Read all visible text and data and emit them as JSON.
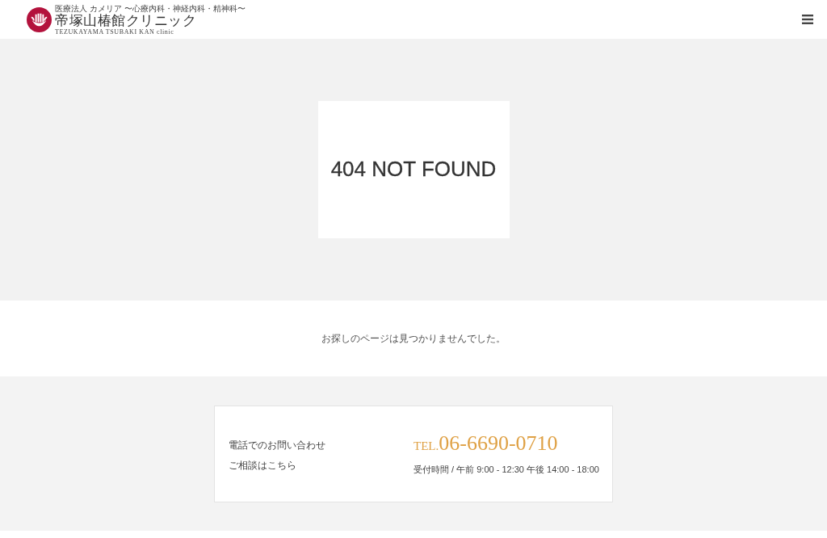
{
  "header": {
    "logo": {
      "tagline": "医療法人 カメリア 〜心療内科・神経内科・精神科〜",
      "name": "帝塚山椿館クリニック",
      "romaji": "TEZUKAYAMA TSUBAKI KAN clinic"
    }
  },
  "error": {
    "title": "404 NOT FOUND",
    "message": "お探しのページは見つかりませんでした。"
  },
  "contact": {
    "lines": [
      "電話でのお問い合わせ",
      "ご相談はこちら"
    ],
    "tel_prefix": "TEL.",
    "tel": "06-6690-0710",
    "hours": "受付時間 / 午前 9:00 - 12:30 午後 14:00 - 18:00"
  }
}
